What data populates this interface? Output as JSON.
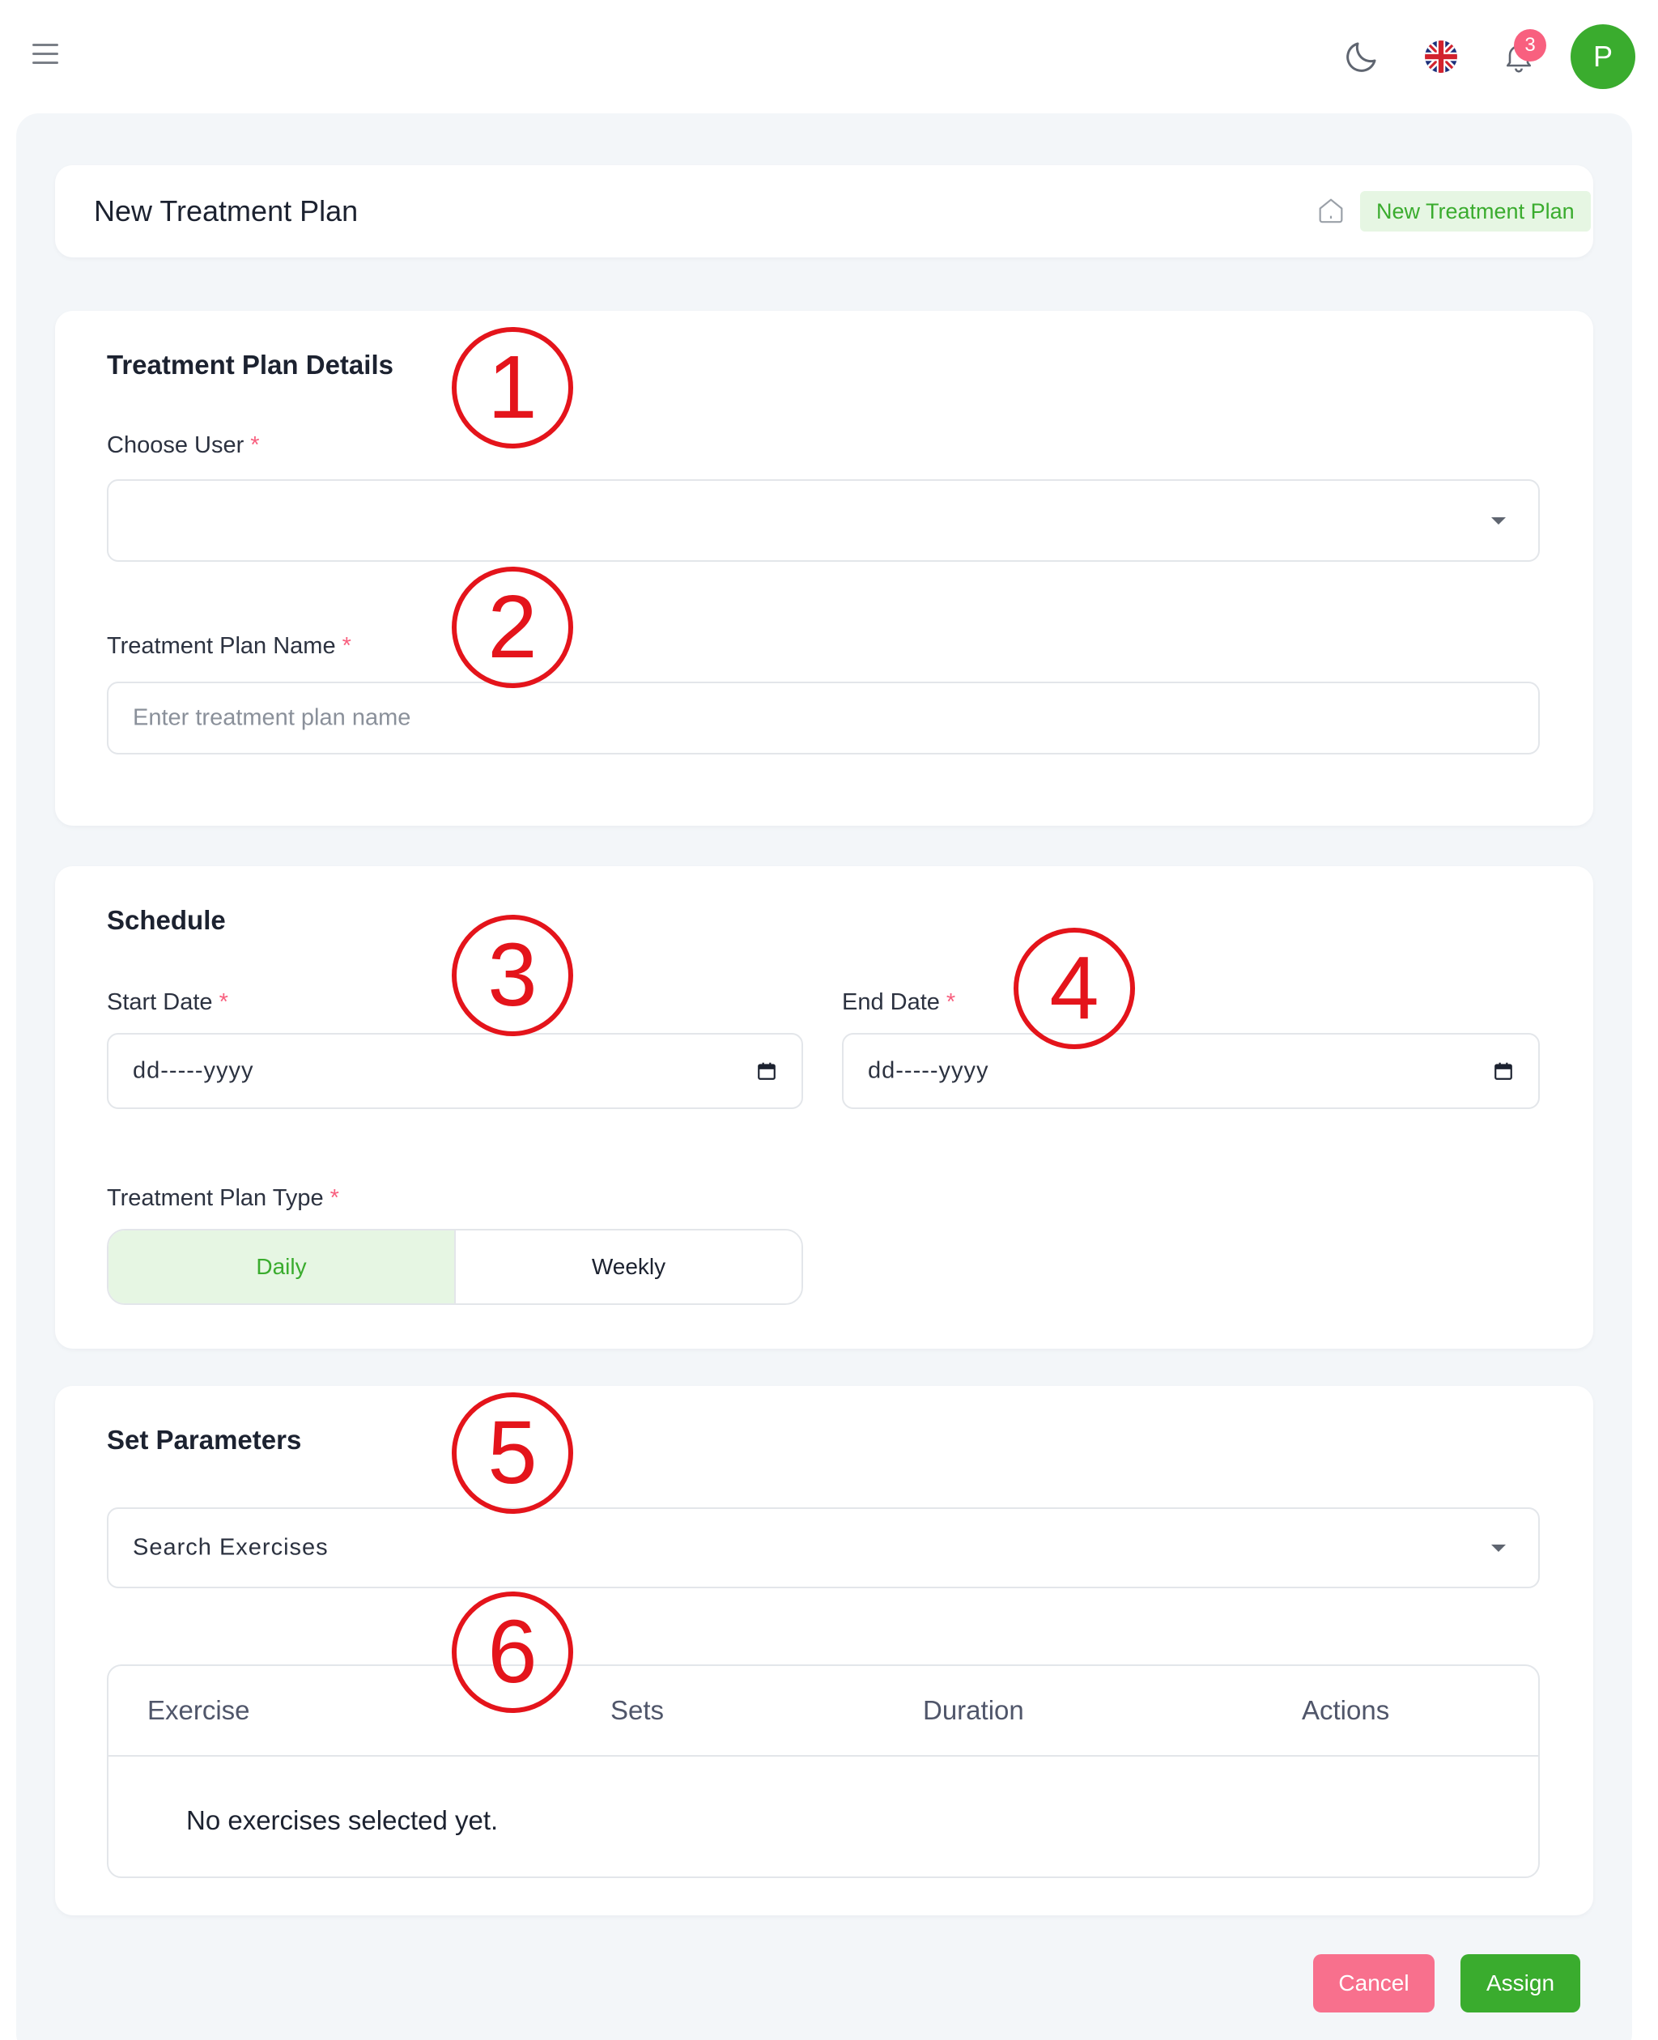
{
  "topbar": {
    "menu_icon": "menu-icon",
    "theme_icon": "moon-icon",
    "language_icon": "uk-flag-icon",
    "notifications_icon": "bell-icon",
    "notification_count": "3",
    "avatar_initial": "P"
  },
  "header": {
    "title": "New Treatment Plan",
    "breadcrumb_icon": "home-icon",
    "breadcrumb_current": "New Treatment Plan"
  },
  "details": {
    "title": "Treatment Plan Details",
    "choose_user_label": "Choose User",
    "choose_user_value": "",
    "plan_name_label": "Treatment Plan Name",
    "plan_name_placeholder": "Enter treatment plan name",
    "required_mark": "*"
  },
  "schedule": {
    "title": "Schedule",
    "start_label": "Start Date",
    "start_value": "dd-----yyyy",
    "end_label": "End Date",
    "end_value": "dd-----yyyy",
    "type_label": "Treatment Plan Type",
    "type_options": [
      "Daily",
      "Weekly"
    ],
    "type_selected": "Daily"
  },
  "parameters": {
    "title": "Set Parameters",
    "search_placeholder": "Search Exercises",
    "columns": [
      "Exercise",
      "Sets",
      "Duration",
      "Actions"
    ],
    "empty_message": "No exercises selected yet."
  },
  "actions": {
    "cancel_label": "Cancel",
    "assign_label": "Assign"
  },
  "annotations": [
    "1",
    "2",
    "3",
    "4",
    "5",
    "6"
  ],
  "colors": {
    "accent": "#3aac2e",
    "accent_soft": "#e6f6e3",
    "danger": "#f8607f",
    "annotation": "#e4141b",
    "page_bg": "#f3f6f9"
  }
}
